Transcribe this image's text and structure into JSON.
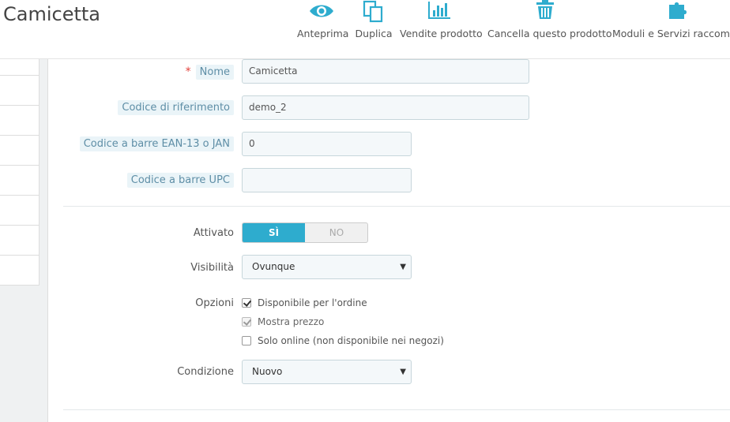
{
  "header": {
    "title": "Camicetta",
    "toolbar": [
      {
        "label": "Anteprima",
        "icon": "eye-icon"
      },
      {
        "label": "Duplica",
        "icon": "copy-icon"
      },
      {
        "label": "Vendite prodotto",
        "icon": "bar-chart-icon"
      },
      {
        "label": "Cancella questo prodotto",
        "icon": "trash-icon"
      },
      {
        "label": "Moduli e Servizi raccomandati",
        "icon": "puzzle-icon"
      }
    ]
  },
  "colors": {
    "accent": "#2eacce",
    "label_hint_bg": "#eaf4f8",
    "required": "#e3423c"
  },
  "form": {
    "name": {
      "label": "Nome",
      "value": "Camicetta",
      "required_marker": "*"
    },
    "reference": {
      "label": "Codice di riferimento",
      "value": "demo_2"
    },
    "ean13": {
      "label": "Codice a barre EAN-13 o JAN",
      "value": "0"
    },
    "upc": {
      "label": "Codice a barre UPC",
      "value": ""
    },
    "active": {
      "label": "Attivato",
      "yes": "SÌ",
      "no": "NO",
      "selected": "yes"
    },
    "visibility": {
      "label": "Visibilità",
      "selected": "Ovunque"
    },
    "options": {
      "label": "Opzioni",
      "items": [
        {
          "label": "Disponibile per l'ordine",
          "checked": true,
          "disabled": false
        },
        {
          "label": "Mostra prezzo",
          "checked": true,
          "disabled": true
        },
        {
          "label": "Solo online (non disponibile nei negozi)",
          "checked": false,
          "disabled": false
        }
      ]
    },
    "condition": {
      "label": "Condizione",
      "selected": "Nuovo"
    }
  }
}
